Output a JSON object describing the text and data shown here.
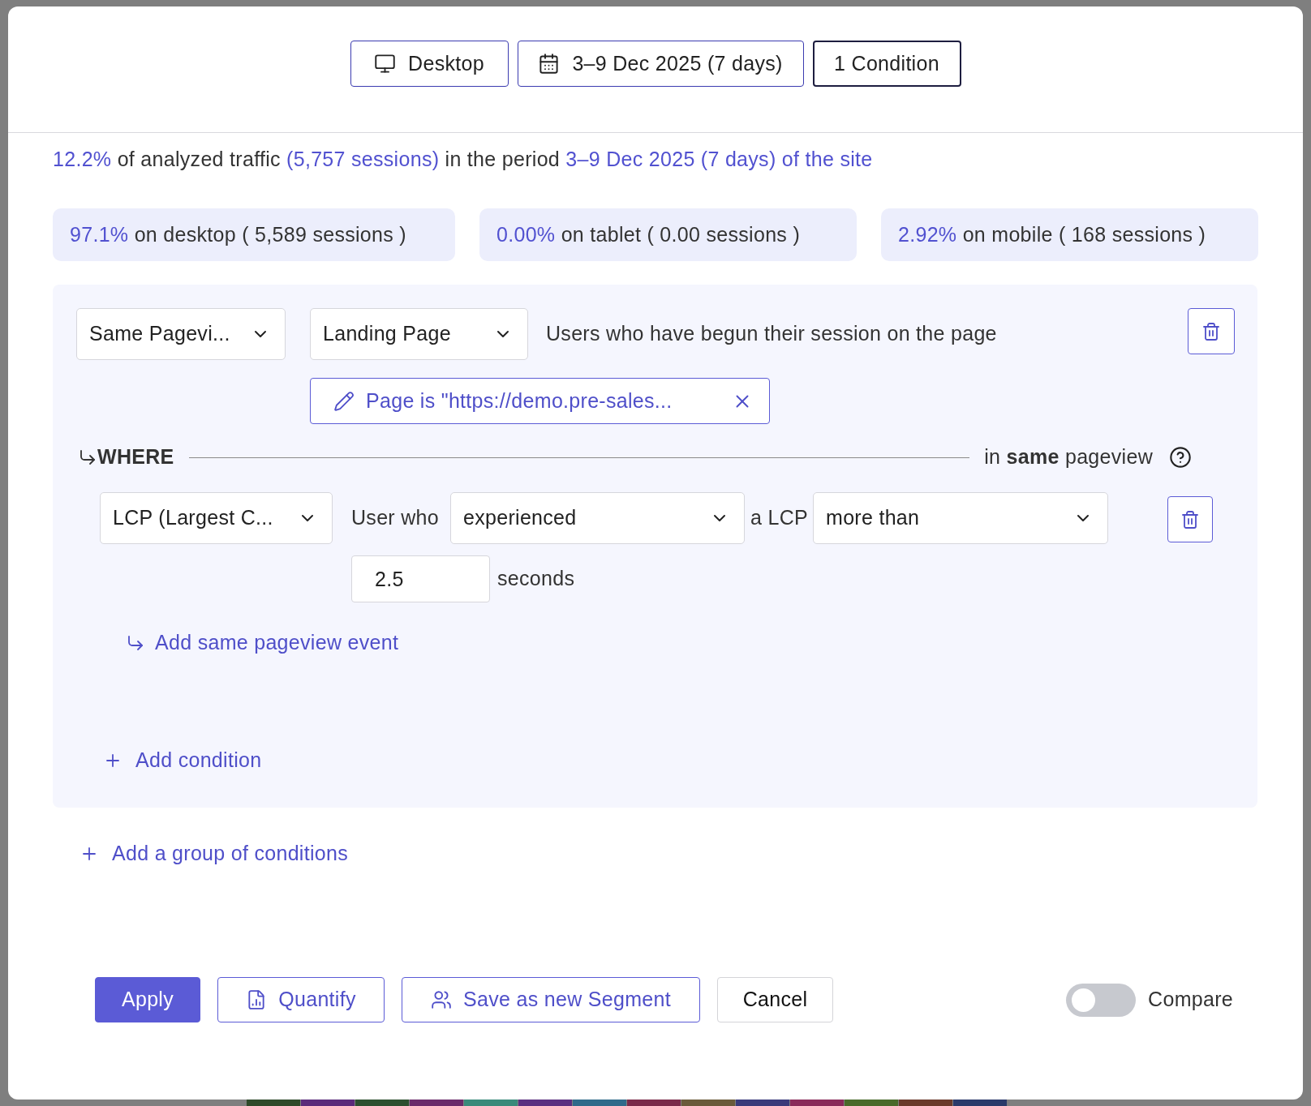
{
  "filter_bar": {
    "buttons": [
      {
        "kind": "device",
        "label": "Desktop",
        "active": false
      },
      {
        "kind": "date",
        "label": "3–9 Dec 2025 (7 days)",
        "active": false
      },
      {
        "kind": "conditions",
        "label": "1 Condition",
        "active": true
      }
    ]
  },
  "summary": {
    "parts": [
      {
        "text": "12.2%",
        "highlight": true
      },
      {
        "text": " of analyzed traffic ",
        "highlight": false
      },
      {
        "text": "(5,757 sessions)",
        "highlight": true
      },
      {
        "text": " in the period ",
        "highlight": false
      },
      {
        "text": "3–9 Dec 2025 (7 days) of the site",
        "highlight": true
      }
    ]
  },
  "device_stats": [
    {
      "percent": "97.1%",
      "text": "on desktop ( 5,589 sessions )"
    },
    {
      "percent": "0.00%",
      "text": "on tablet ( 0.00 sessions )"
    },
    {
      "percent": "2.92%",
      "text": "on mobile ( 168 sessions )"
    }
  ],
  "condition_group": {
    "event_select": "Same Pagevi...",
    "type_select": "Landing Page",
    "description": "Users who have begun their session on the page",
    "filter_chip": "Page is \"https://demo.pre-sales...",
    "where": {
      "label": "WHERE",
      "scope": "in **same** pageview"
    },
    "sub_conditions": [
      {
        "metric_select": "LCP (Largest C...",
        "prefix": "User who",
        "verb_select": "experienced",
        "metric_label": "a LCP",
        "operator_select": "more than",
        "value": "2.5",
        "unit": "seconds"
      }
    ],
    "add_event_link": "Add same pageview event",
    "add_condition_link": "Add condition"
  },
  "add_group_link": "Add a group of conditions",
  "footer": {
    "buttons": [
      {
        "kind": "primary",
        "label": "Apply"
      },
      {
        "kind": "quantify",
        "label": "Quantify"
      },
      {
        "kind": "segment",
        "label": "Save as new Segment"
      },
      {
        "kind": "cancel",
        "label": "Cancel"
      }
    ],
    "compare": {
      "label": "Compare",
      "on": false
    }
  }
}
